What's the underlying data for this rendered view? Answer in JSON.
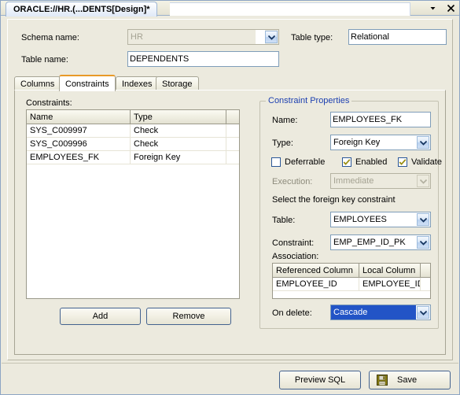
{
  "window": {
    "title": "ORACLE://HR.(...DENTS[Design]*",
    "dropdown_icon": "chevron-down-icon",
    "close_icon": "close-icon"
  },
  "header": {
    "schema_label": "Schema name:",
    "schema_value": "HR",
    "table_name_label": "Table name:",
    "table_name_value": "DEPENDENTS",
    "table_type_label": "Table type:",
    "table_type_value": "Relational"
  },
  "tabs": [
    {
      "label": "Columns",
      "active": false
    },
    {
      "label": "Constraints",
      "active": true
    },
    {
      "label": "Indexes",
      "active": false
    },
    {
      "label": "Storage",
      "active": false
    }
  ],
  "constraints_panel": {
    "list_label": "Constraints:",
    "columns": [
      "Name",
      "Type"
    ],
    "rows": [
      {
        "name": "SYS_C009997",
        "type": "Check"
      },
      {
        "name": "SYS_C009996",
        "type": "Check"
      },
      {
        "name": "EMPLOYEES_FK",
        "type": "Foreign Key"
      }
    ],
    "add_label": "Add",
    "remove_label": "Remove"
  },
  "properties": {
    "group_title": "Constraint Properties",
    "name_label": "Name:",
    "name_value": "EMPLOYEES_FK",
    "type_label": "Type:",
    "type_value": "Foreign Key",
    "deferrable_label": "Deferrable",
    "deferrable_checked": false,
    "enabled_label": "Enabled",
    "enabled_checked": true,
    "validate_label": "Validate",
    "validate_checked": true,
    "execution_label": "Execution:",
    "execution_value": "Immediate",
    "fk_section_label": "Select the foreign key constraint",
    "fk_table_label": "Table:",
    "fk_table_value": "EMPLOYEES",
    "fk_constraint_label": "Constraint:",
    "fk_constraint_value": "EMP_EMP_ID_PK",
    "association_label": "Association:",
    "association_columns": [
      "Referenced Column",
      "Local Column"
    ],
    "association_rows": [
      {
        "referenced": "EMPLOYEE_ID",
        "local": "EMPLOYEE_ID"
      }
    ],
    "on_delete_label": "On delete:",
    "on_delete_value": "Cascade"
  },
  "footer": {
    "preview_sql_label": "Preview SQL",
    "save_label": "Save",
    "save_icon": "floppy-disk-icon"
  },
  "colors": {
    "accent_tab": "#e89a28",
    "group_label": "#1c3fb0",
    "selection": "#2254c6",
    "check_mark": "#9a8f14",
    "window_bg": "#eceade"
  }
}
